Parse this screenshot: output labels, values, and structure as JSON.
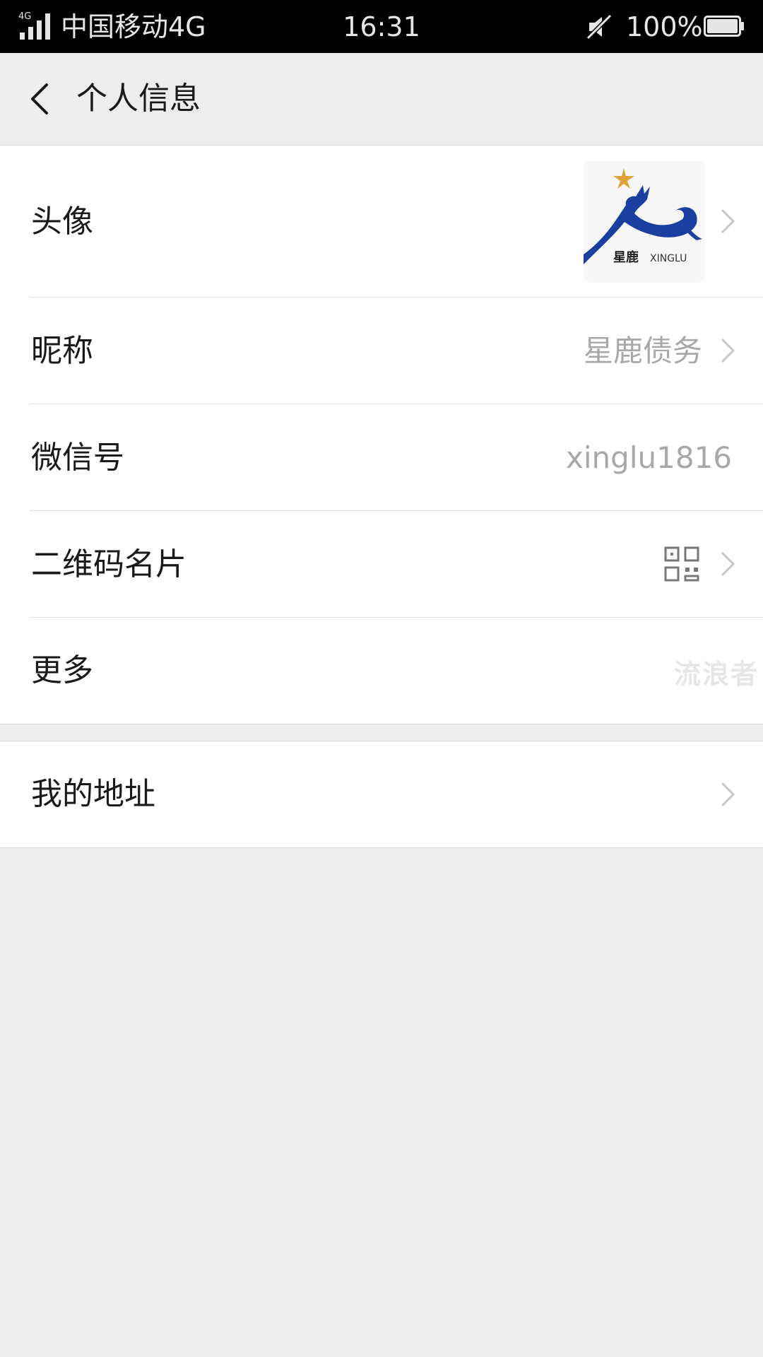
{
  "status_bar": {
    "network_badge": "4G",
    "carrier": "中国移动4G",
    "time": "16:31",
    "battery_percent": "100%",
    "battery_level": 1.0,
    "mute_icon": "mute-icon"
  },
  "nav": {
    "title": "个人信息",
    "back_icon": "back-chevron-icon"
  },
  "profile": {
    "avatar": {
      "label": "头像",
      "logo_text_cn": "星鹿",
      "logo_text_en": "XINGLU"
    },
    "nickname": {
      "label": "昵称",
      "value": "星鹿债务"
    },
    "wechat_id": {
      "label": "微信号",
      "value": "xinglu1816"
    },
    "qr_card": {
      "label": "二维码名片",
      "icon": "qr-code-icon"
    },
    "more": {
      "label": "更多",
      "watermark": "流浪者"
    }
  },
  "address": {
    "label": "我的地址"
  },
  "colors": {
    "status_bar_bg": "#000000",
    "page_bg": "#ededed",
    "cell_bg": "#ffffff",
    "secondary_text": "#a8a8a8",
    "logo_blue": "#1b3fa0",
    "logo_star": "#e3a237"
  }
}
